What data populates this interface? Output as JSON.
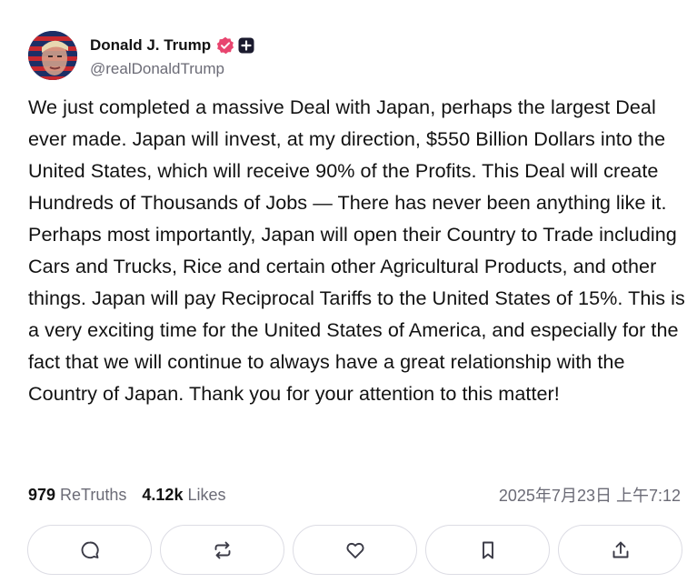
{
  "author": {
    "display_name": "Donald J. Trump",
    "handle": "@realDonaldTrump",
    "verified_badge_color": "#e8456f"
  },
  "post": {
    "text": "We just completed a massive Deal with Japan, perhaps the largest Deal ever made. Japan will invest, at my direction, $550 Billion Dollars into the United States, which will receive 90% of the Profits. This Deal will create Hundreds of Thousands of Jobs — There has never been anything like it. Perhaps most importantly, Japan will open their Country to Trade including Cars and Trucks, Rice and certain other Agricultural Products, and other things. Japan will pay Reciprocal Tariffs to the United States of 15%. This is a very exciting time for the United States of America, and especially for the fact that we will continue to always have a great relationship with the Country of Japan. Thank you for your attention to this matter!"
  },
  "stats": {
    "retruths_count": "979",
    "retruths_label": "ReTruths",
    "likes_count": "4.12k",
    "likes_label": "Likes",
    "timestamp": "2025年7月23日 上午7:12"
  },
  "actions": [
    {
      "icon": "comment-icon"
    },
    {
      "icon": "retruth-icon"
    },
    {
      "icon": "heart-icon"
    },
    {
      "icon": "bookmark-icon"
    },
    {
      "icon": "share-icon"
    }
  ]
}
